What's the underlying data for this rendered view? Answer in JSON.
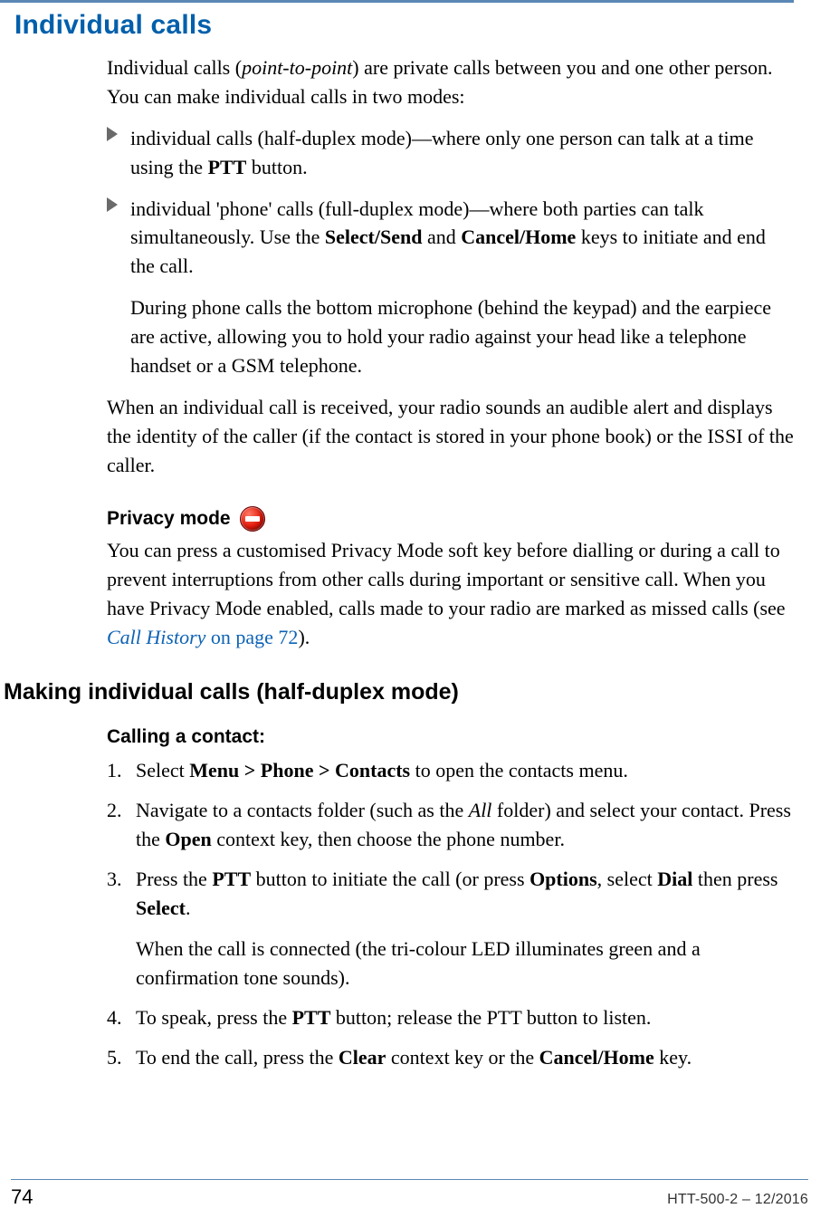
{
  "heading": "Individual calls",
  "intro_parts": {
    "p1a": "Individual calls (",
    "p1b_em": "point-to-point",
    "p1c": ") are private calls between you and one other person. You can make individual calls in two modes:"
  },
  "bullets": [
    {
      "parts": {
        "a": "individual calls (half-duplex mode)—where only one person can talk at a time using the ",
        "b_bold": "PTT",
        "c": " button."
      }
    },
    {
      "parts": {
        "a": "individual 'phone' calls (full-duplex mode)—where both parties can talk simultaneously. Use the ",
        "b_bold": "Select/Send",
        "c": " and ",
        "d_bold": "Cancel/Home",
        "e": " keys to initiate and end the call."
      },
      "sub": "During phone calls the bottom microphone (behind the keypad) and the earpiece are active, allowing you to hold your radio against your head like a telephone handset or a GSM telephone."
    }
  ],
  "para2": "When an individual call is received, your radio sounds an audible alert and displays the identity of the caller (if the contact is stored in your phone book) or the ISSI of the caller.",
  "privacy": {
    "title": "Privacy mode",
    "text_a": "You can press a customised Privacy Mode soft key before dialling or during a call to prevent interruptions from other calls during important or sensitive call. When you have Privacy Mode enabled, calls made to your radio are marked as missed calls (see ",
    "link_em": "Call History",
    "link_plain": "  on page 72",
    "text_b": ")."
  },
  "h2": "Making individual calls (half-duplex mode)",
  "h3": "Calling a contact:",
  "steps": [
    {
      "a": "Select ",
      "b_bold": "Menu > Phone > Contacts",
      "c": " to open the contacts menu."
    },
    {
      "a": "Navigate to a contacts folder (such as the ",
      "b_em": "All",
      "c": " folder) and select your contact. Press the ",
      "d_bold": "Open",
      "e": " context key, then choose the phone number."
    },
    {
      "a": "Press the ",
      "b_bold": "PTT",
      "c": " button to initiate the call (or press ",
      "d_bold": "Options",
      "e": ", select ",
      "f_bold": "Dial",
      "g": " then press ",
      "h_bold": "Select",
      "i": ".",
      "after": "When the call is connected (the tri-colour LED illuminates green and a confirmation tone sounds)."
    },
    {
      "a": "To speak, press the ",
      "b_bold": "PTT",
      "c": " button; release the PTT button to listen."
    },
    {
      "a": "To end the call, press the ",
      "b_bold": "Clear",
      "c": " context key or the ",
      "d_bold": "Cancel/Home",
      "e": " key."
    }
  ],
  "footer": {
    "page": "74",
    "doc": "HTT-500-2 – 12/2016"
  }
}
